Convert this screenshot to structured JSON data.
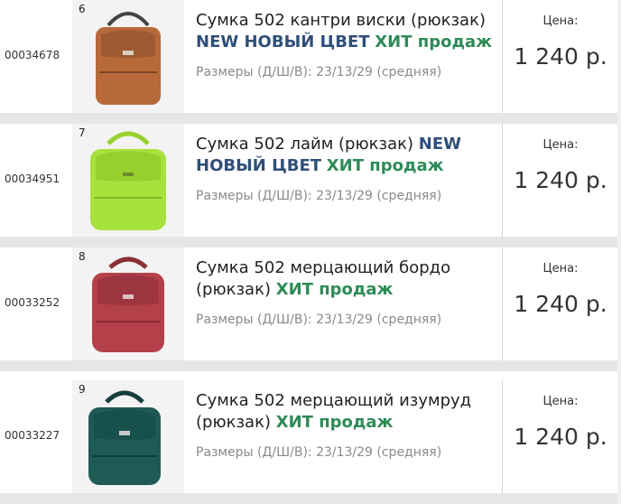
{
  "items": [
    {
      "index": "6",
      "sku": "00034678",
      "title": "Сумка 502 кантри виски (рюкзак)",
      "badges": {
        "new": "NEW НОВЫЙ ЦВЕТ",
        "hit": "ХИТ продаж"
      },
      "sizes": "Размеры (Д/Ш/В): 23/13/29 (средняя)",
      "price_label": "Цена:",
      "price": "1 240 р.",
      "color": "#b8693a"
    },
    {
      "index": "7",
      "sku": "00034951",
      "title": "Сумка 502 лайм (рюкзак)",
      "badges": {
        "new": "NEW НОВЫЙ ЦВЕТ",
        "hit": "ХИТ продаж"
      },
      "sizes": "Размеры (Д/Ш/В): 23/13/29 (средняя)",
      "price_label": "Цена:",
      "price": "1 240 р.",
      "color": "#a7e23c"
    },
    {
      "index": "8",
      "sku": "00033252",
      "title": "Сумка 502 мерцающий бордо (рюкзак)",
      "badges": {
        "hit": "ХИТ продаж"
      },
      "sizes": "Размеры (Д/Ш/В): 23/13/29 (средняя)",
      "price_label": "Цена:",
      "price": "1 240 р.",
      "color": "#b4404a"
    },
    {
      "index": "9",
      "sku": "00033227",
      "title": "Сумка 502 мерцающий изумруд (рюкзак)",
      "badges": {
        "hit": "ХИТ продаж"
      },
      "sizes": "Размеры (Д/Ш/В): 23/13/29 (средняя)",
      "price_label": "Цена:",
      "price": "1 240 р.",
      "color": "#1f5a55"
    }
  ]
}
